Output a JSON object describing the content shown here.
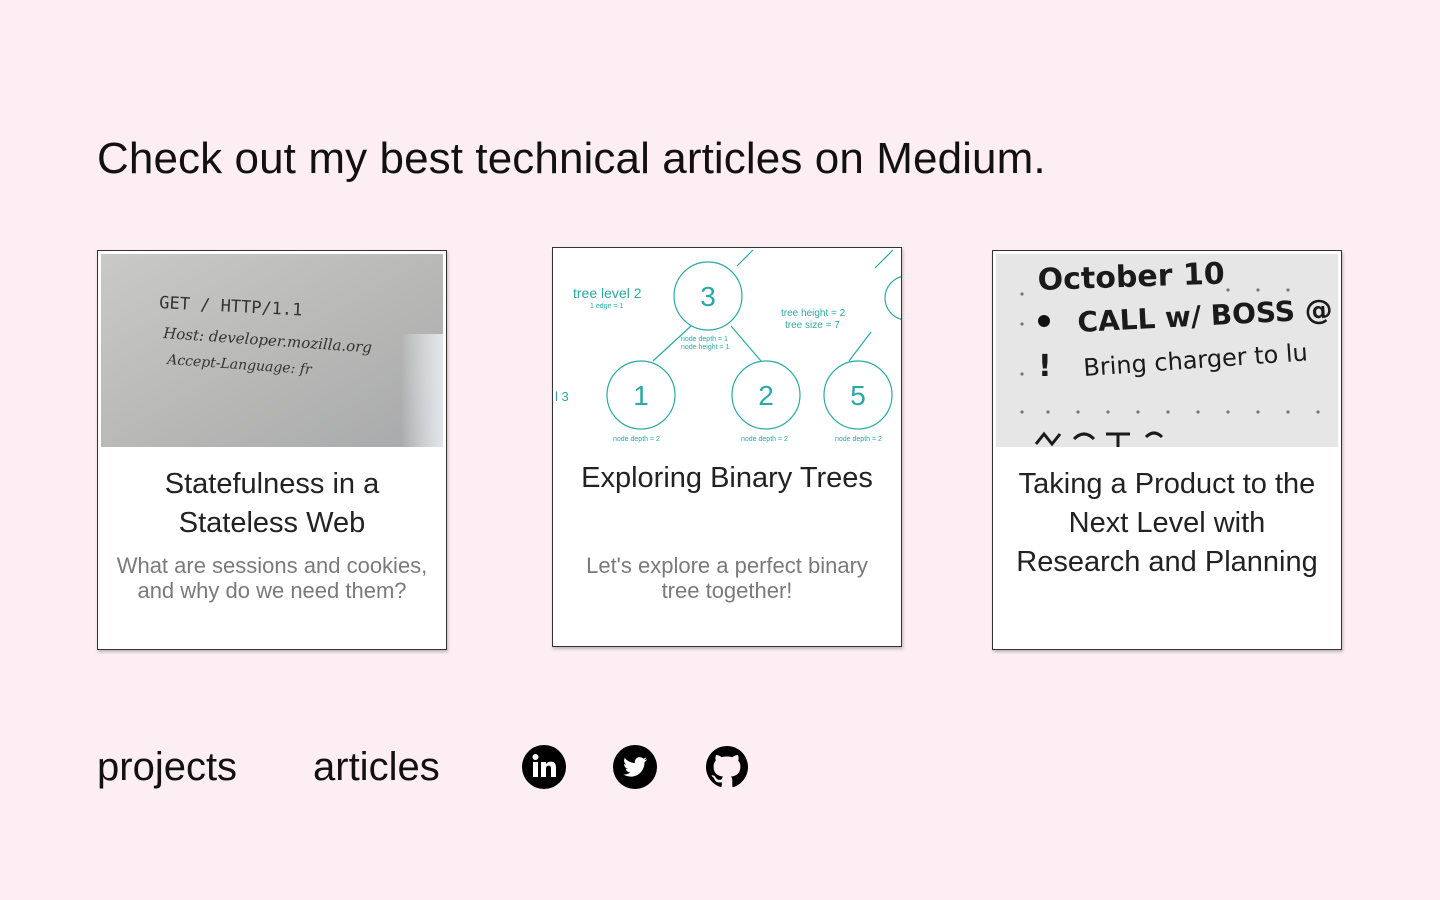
{
  "headline": "Check out my best technical articles on Medium.",
  "articles": [
    {
      "title": "Statefulness in a Stateless Web",
      "description": "What are sessions and cookies, and why do we need them?",
      "image": {
        "line1": "GET / HTTP/1.1",
        "line2": "Host: developer.mozilla.org",
        "line3": "Accept-Language: fr"
      }
    },
    {
      "title": "Exploring Binary Trees",
      "description": "Let's explore a perfect binary tree together!",
      "image": {
        "tree_level": "tree level 2",
        "edge_note": "1 edge = 1",
        "tree_height": "tree height = 2",
        "tree_size": "tree size = 7",
        "node_depth_1": "node depth = 1",
        "node_height_1": "node height = 1",
        "node_depth_2": "node depth = 2",
        "node_3": "3",
        "node_1": "1",
        "node_2": "2",
        "node_5": "5",
        "left_label": "l 3"
      }
    },
    {
      "title": "Taking a Product to the Next Level with Research and Planning",
      "description": "",
      "image": {
        "line1": "October 10",
        "line2": "CALL w/ BOSS @",
        "line3": "Bring charger to lu"
      }
    }
  ],
  "footer": {
    "projects_label": "projects",
    "articles_label": "articles"
  },
  "social": [
    {
      "name": "linkedin-icon"
    },
    {
      "name": "twitter-icon"
    },
    {
      "name": "github-icon"
    }
  ],
  "colors": {
    "background": "#fdeef3",
    "teal": "#2aa9a6",
    "text": "#111111",
    "muted": "#7a7a7a"
  }
}
